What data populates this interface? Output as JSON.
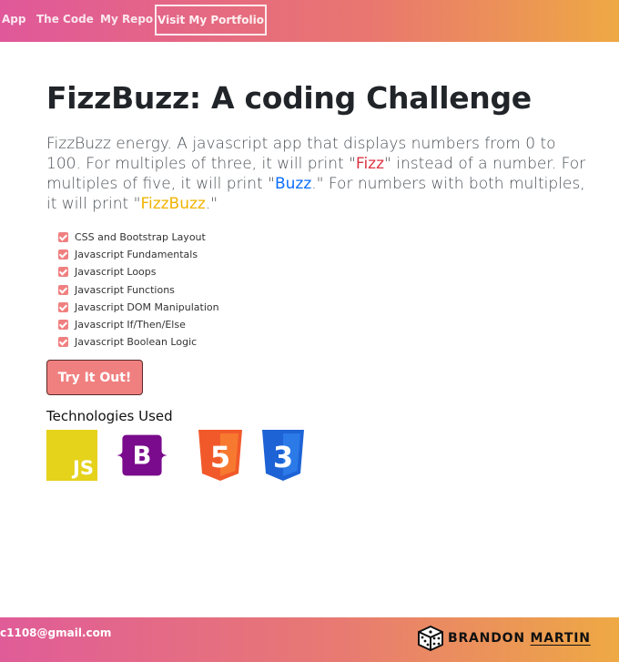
{
  "nav": {
    "links": [
      "App",
      "The Code",
      "My Repo"
    ],
    "portfolio_label": "Visit My Portfolio"
  },
  "main": {
    "title": "FizzBuzz: A coding Challenge",
    "intro": {
      "part1": "FizzBuzz energy. A javascript app that displays numbers from 0 to 100. For multiples of three, it will print \"",
      "fizz": "Fizz",
      "part2": "\" instead of a number. For multiples of five, it will print \"",
      "buzz": "Buzz",
      "part3": ".\" For numbers with both multiples, it will print \"",
      "fizzbuzz": "FizzBuzz",
      "part4": ".\""
    },
    "checklist": [
      "CSS and Bootstrap Layout",
      "Javascript Fundamentals",
      "Javascript Loops",
      "Javascript Functions",
      "Javascript DOM Manipulation",
      "Javascript If/Then/Else",
      "Javascript Boolean Logic"
    ],
    "try_label": "Try It Out!",
    "technologies_title": "Technologies Used",
    "technologies": [
      {
        "icon": "javascript-icon",
        "label": "JS",
        "color": "#e5d21b"
      },
      {
        "icon": "bootstrap-icon",
        "label": "B",
        "color": "#7a0b8c"
      },
      {
        "icon": "html5-icon",
        "label": "5",
        "color": "#f1592a"
      },
      {
        "icon": "css3-icon",
        "label": "3",
        "color": "#1e63d6"
      }
    ]
  },
  "footer": {
    "email": "c1108@gmail.com",
    "brand_first": "BRANDON",
    "brand_last": "MARTIN"
  },
  "colors": {
    "accent": "#f08080",
    "fizz": "#dc3545",
    "buzz": "#0d6efd",
    "fizzbuzz": "#f0b400"
  }
}
